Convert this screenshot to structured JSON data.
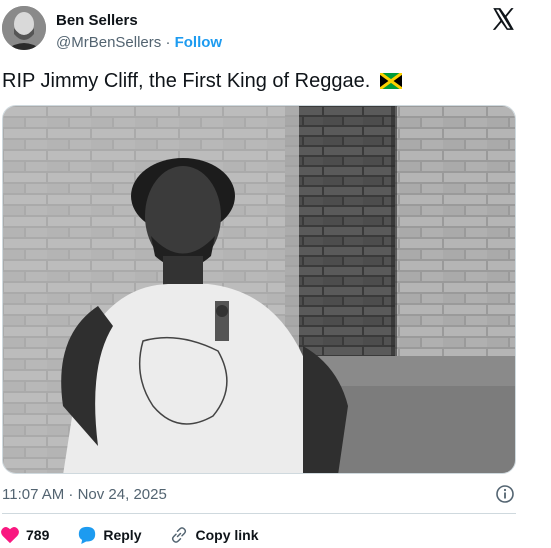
{
  "author": {
    "name": "Ben Sellers",
    "handle": "@MrBenSellers",
    "separator": "·",
    "follow_label": "Follow"
  },
  "tweet": {
    "text": "RIP Jimmy Cliff, the First King of Reggae.",
    "flag_icon": "jamaica-flag-icon"
  },
  "meta": {
    "timestamp": "11:07 AM · Nov 24, 2025"
  },
  "actions": {
    "like_count": "789",
    "reply_label": "Reply",
    "copy_link_label": "Copy link"
  },
  "colors": {
    "accent": "#1d9bf0",
    "like": "#f91880",
    "muted": "#536471"
  }
}
